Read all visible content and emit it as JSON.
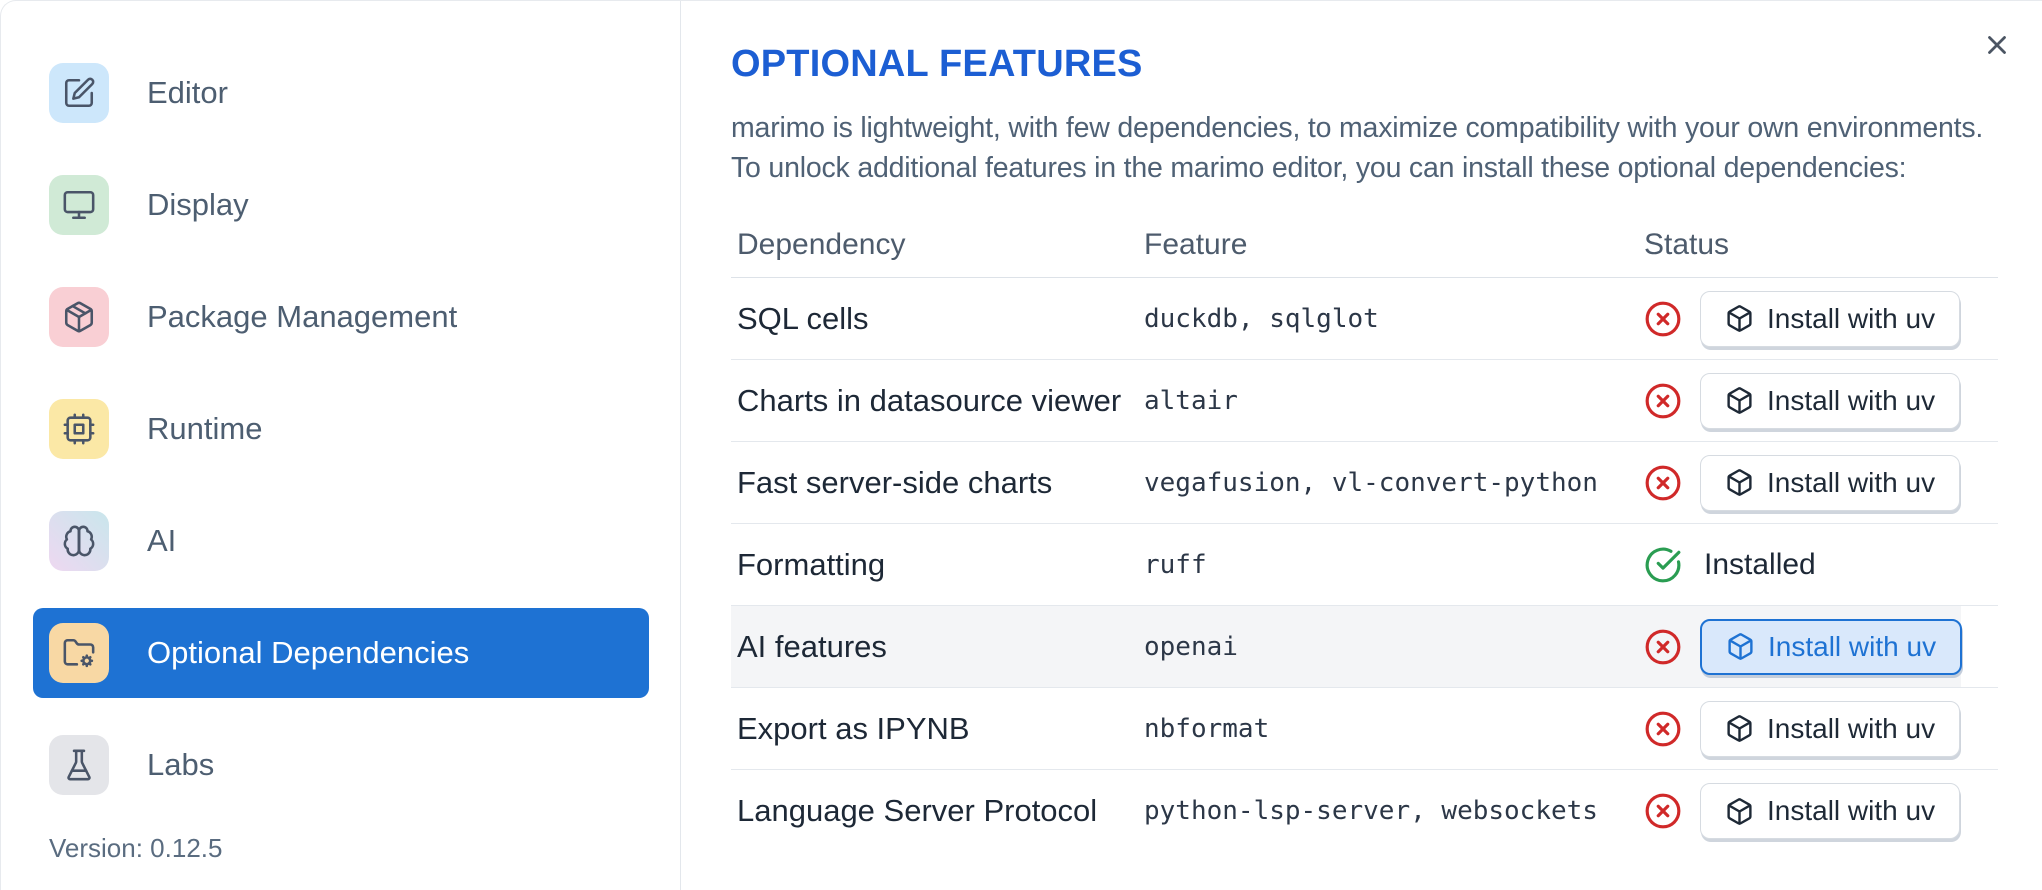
{
  "colors": {
    "accent_blue": "#1e72d3",
    "heading_blue": "#1c5ed3",
    "error_red": "#d02929",
    "success_green": "#2a9d52",
    "highlight_row_bg": "#f4f5f7",
    "focused_button_bg": "#d9e8fb"
  },
  "sidebar": {
    "items": [
      {
        "label": "Editor",
        "icon": "square-pen",
        "icon_bg": "#cde7fb",
        "selected": false
      },
      {
        "label": "Display",
        "icon": "monitor",
        "icon_bg": "#d0ead6",
        "selected": false
      },
      {
        "label": "Package Management",
        "icon": "package",
        "icon_bg": "#f9cfd4",
        "selected": false
      },
      {
        "label": "Runtime",
        "icon": "cpu",
        "icon_bg": "#fbe8a6",
        "selected": false
      },
      {
        "label": "AI",
        "icon": "brain",
        "icon_bg": "linear-gradient(45deg,#eed8f1,#c9e6ec)",
        "selected": false
      },
      {
        "label": "Optional Dependencies",
        "icon": "folder-cog",
        "icon_bg": "#f8d8a4",
        "selected": true
      },
      {
        "label": "Labs",
        "icon": "flask",
        "icon_bg": "#e4e5e9",
        "selected": false
      }
    ],
    "version": "Version: 0.12.5"
  },
  "panel": {
    "title": "OPTIONAL FEATURES",
    "description_lines": [
      "marimo is lightweight, with few dependencies, to maximize compatibility with your own environments.",
      "To unlock additional features in the marimo editor, you can install these optional dependencies:"
    ],
    "table": {
      "headers": [
        "Dependency",
        "Feature",
        "Status"
      ],
      "rows": [
        {
          "dependency": "SQL cells",
          "feature": "duckdb, sqlglot",
          "status": "missing",
          "action_label": "Install with uv",
          "highlighted": false
        },
        {
          "dependency": "Charts in datasource viewer",
          "feature": "altair",
          "status": "missing",
          "action_label": "Install with uv",
          "highlighted": false
        },
        {
          "dependency": "Fast server-side charts",
          "feature": "vegafusion, vl-convert-python",
          "status": "missing",
          "action_label": "Install with uv",
          "highlighted": false
        },
        {
          "dependency": "Formatting",
          "feature": "ruff",
          "status": "installed",
          "status_label": "Installed",
          "highlighted": false
        },
        {
          "dependency": "AI features",
          "feature": "openai",
          "status": "missing",
          "action_label": "Install with uv",
          "highlighted": true
        },
        {
          "dependency": "Export as IPYNB",
          "feature": "nbformat",
          "status": "missing",
          "action_label": "Install with uv",
          "highlighted": false
        },
        {
          "dependency": "Language Server Protocol",
          "feature": "python-lsp-server, websockets",
          "status": "missing",
          "action_label": "Install with uv",
          "highlighted": false
        }
      ]
    }
  }
}
